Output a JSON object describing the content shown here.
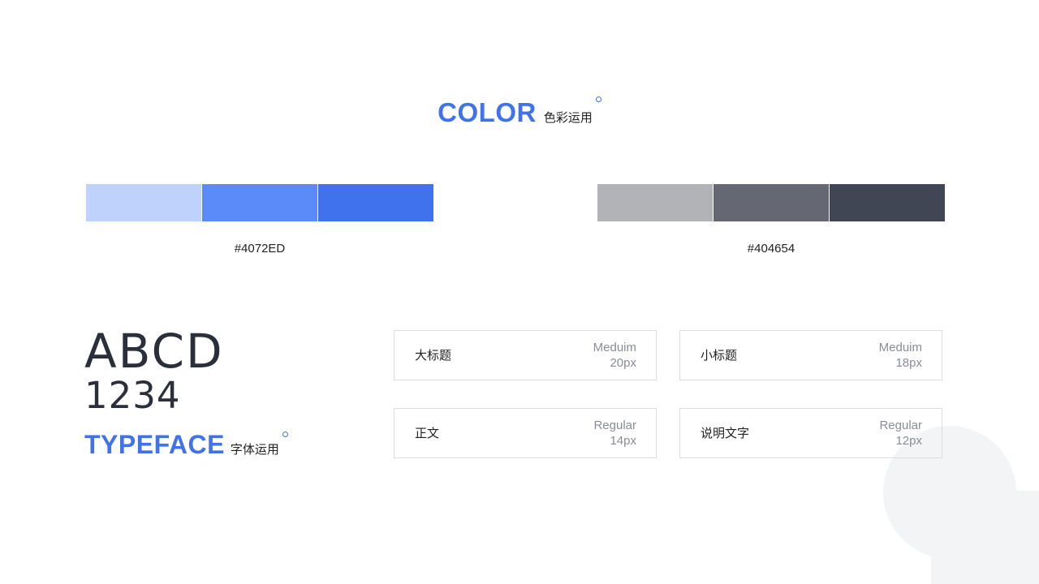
{
  "color_section": {
    "title_en": "COLOR",
    "title_cn": "色彩运用",
    "accent": "#4072ED"
  },
  "swatches": {
    "blue": {
      "label": "#4072ED",
      "colors": [
        "#BFD2FB",
        "#5A8BF9",
        "#4072ED"
      ]
    },
    "gray": {
      "label": "#404654",
      "colors": [
        "#B2B3B7",
        "#656873",
        "#404654"
      ]
    }
  },
  "typeface_section": {
    "sample_letters": "ABCD",
    "sample_digits": "1234",
    "title_en": "TYPEFACE",
    "title_cn": "字体运用"
  },
  "font_cards": [
    {
      "name": "大标题",
      "weight": "Meduim",
      "size": "20px"
    },
    {
      "name": "小标题",
      "weight": "Meduim",
      "size": "18px"
    },
    {
      "name": "正文",
      "weight": "Regular",
      "size": "14px"
    },
    {
      "name": "说明文字",
      "weight": "Regular",
      "size": "12px"
    }
  ]
}
